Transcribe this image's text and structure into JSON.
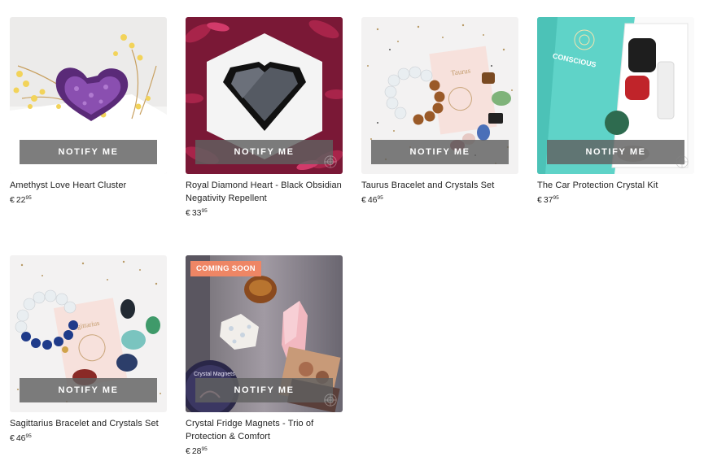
{
  "products": [
    {
      "title": "Amethyst Love Heart Cluster",
      "currency": "€",
      "price_whole": "22",
      "price_cents": "95",
      "button": "NOTIFY ME",
      "badge": ""
    },
    {
      "title": "Royal Diamond Heart - Black Obsidian Negativity Repellent",
      "currency": "€",
      "price_whole": "33",
      "price_cents": "95",
      "button": "NOTIFY ME",
      "badge": ""
    },
    {
      "title": "Taurus Bracelet and Crystals Set",
      "currency": "€",
      "price_whole": "46",
      "price_cents": "95",
      "button": "NOTIFY ME",
      "badge": "",
      "art_text": "Taurus"
    },
    {
      "title": "The Car Protection Crystal Kit",
      "currency": "€",
      "price_whole": "37",
      "price_cents": "95",
      "button": "NOTIFY ME",
      "badge": "",
      "art_text": "CONSCIOUS"
    },
    {
      "title": "Sagittarius Bracelet and Crystals Set",
      "currency": "€",
      "price_whole": "46",
      "price_cents": "95",
      "button": "NOTIFY ME",
      "badge": "",
      "art_text": "Sagittarius"
    },
    {
      "title": "Crystal Fridge Magnets - Trio of Protection & Comfort",
      "currency": "€",
      "price_whole": "28",
      "price_cents": "95",
      "button": "NOTIFY ME",
      "badge": "COMING SOON",
      "art_text": "Crystal Magnets"
    }
  ],
  "colors": {
    "badge": "#ee8665",
    "notify_overlay": "#606060",
    "teal_box": "#5fd3c8"
  },
  "icons": {
    "watermark": "mandala-logo-icon"
  }
}
